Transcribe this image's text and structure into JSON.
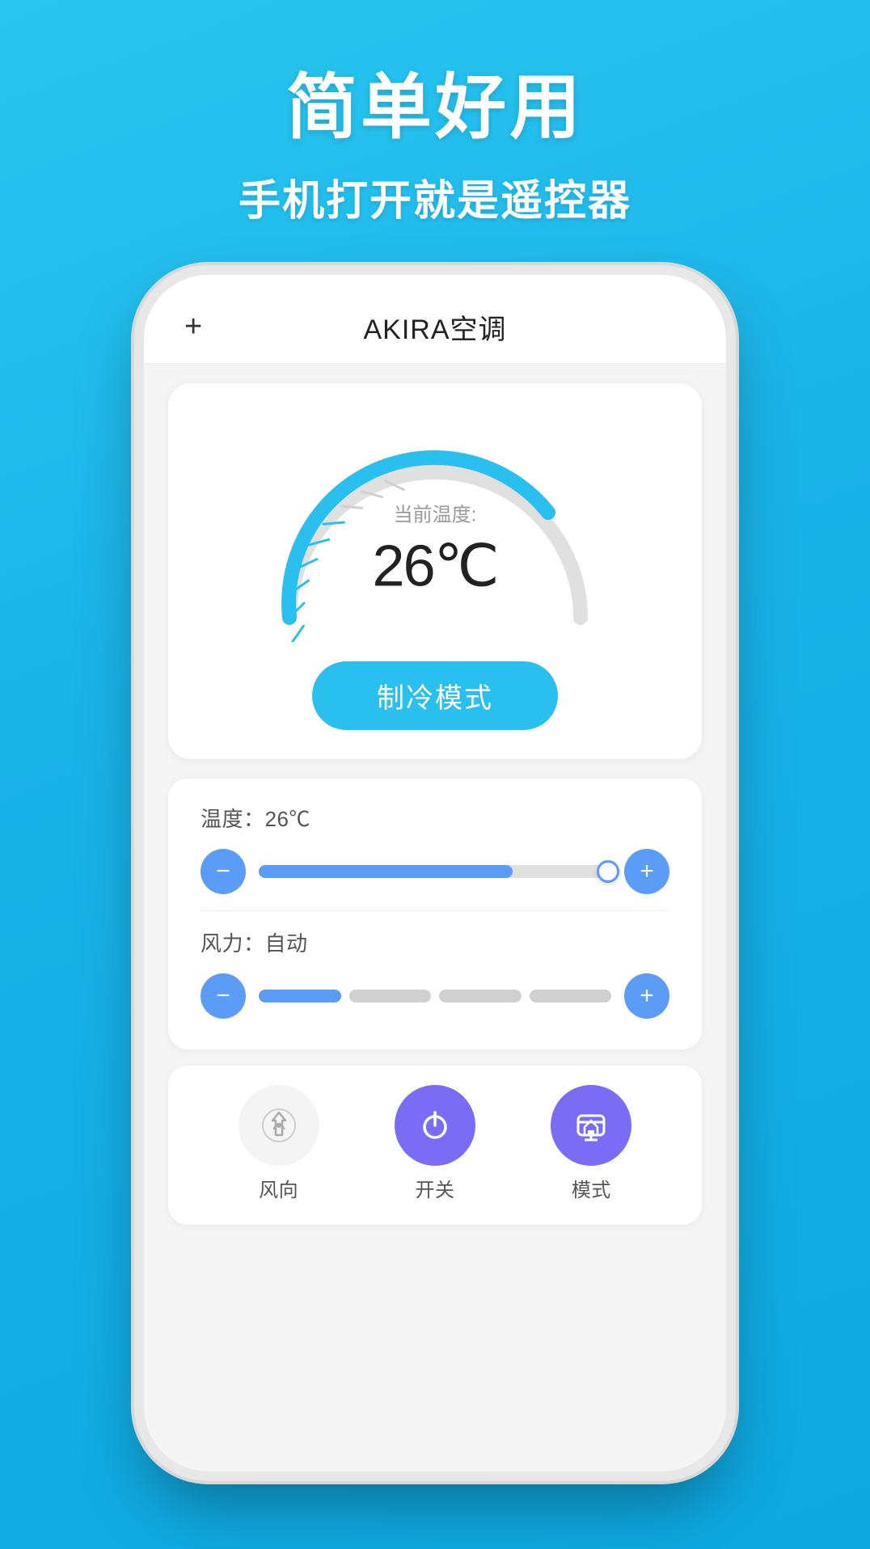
{
  "app": {
    "background_color": "#29c6f0",
    "title_main": "简单好用",
    "title_sub": "手机打开就是遥控器"
  },
  "phone": {
    "topbar": {
      "plus_label": "+",
      "title": "AKIRA空调"
    },
    "gauge": {
      "label": "当前温度:",
      "value": "26℃",
      "mode_button": "制冷模式"
    },
    "temperature_control": {
      "label": "温度：26℃",
      "minus_label": "−",
      "plus_label": "+"
    },
    "wind_control": {
      "label": "风力：自动",
      "minus_label": "−",
      "plus_label": "+"
    },
    "bottom_nav": {
      "wind_dir": "风向",
      "power": "开关",
      "mode": "模式"
    }
  }
}
